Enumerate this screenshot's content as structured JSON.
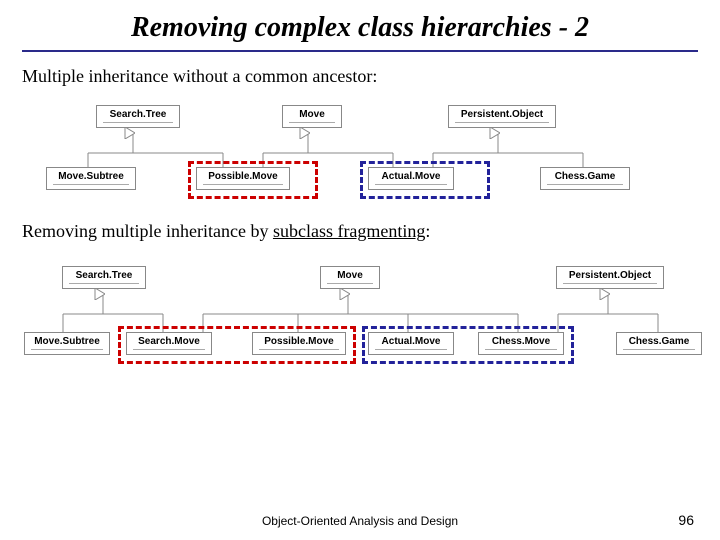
{
  "title": "Removing complex class hierarchies - 2",
  "intro": "Multiple inheritance without a common ancestor:",
  "section2_a": "Removing multiple inheritance by ",
  "section2_b": "subclass fragmenting",
  "section2_c": ":",
  "d1": {
    "top": {
      "search_tree": "Search.Tree",
      "move": "Move",
      "persistent_object": "Persistent.Object"
    },
    "bottom": {
      "move_subtree": "Move.Subtree",
      "possible_move": "Possible.Move",
      "actual_move": "Actual.Move",
      "chess_game": "Chess.Game"
    }
  },
  "d2": {
    "top": {
      "search_tree": "Search.Tree",
      "move": "Move",
      "persistent_object": "Persistent.Object"
    },
    "bottom": {
      "move_subtree": "Move.Subtree",
      "search_move": "Search.Move",
      "possible_move": "Possible.Move",
      "actual_move": "Actual.Move",
      "chess_move": "Chess.Move",
      "chess_game": "Chess.Game"
    }
  },
  "footer": "Object-Oriented Analysis and Design",
  "page": "96"
}
